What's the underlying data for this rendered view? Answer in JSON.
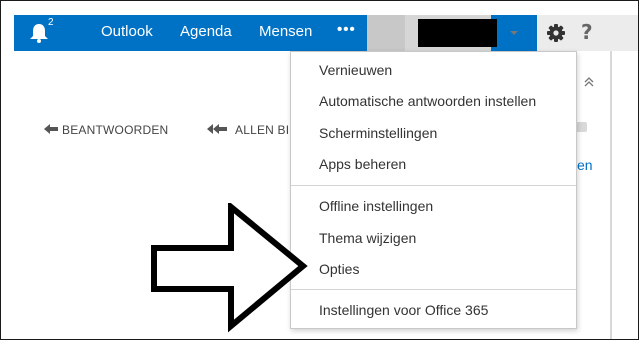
{
  "topbar": {
    "notification_count": "2",
    "links": [
      "Outlook",
      "Agenda",
      "Mensen"
    ],
    "more_label": "•••",
    "help_label": "?",
    "icons": [
      "bell-icon",
      "chevron-down-icon",
      "gear-icon",
      "help-icon"
    ],
    "colors": {
      "bar": "#0072c6",
      "text": "#ffffff"
    }
  },
  "mail_toolbar": {
    "reply_label": "BEANTWOORDEN",
    "reply_all_label": "ALLEN BI",
    "partial_link_text": "en"
  },
  "settings_menu": {
    "groups": [
      [
        "Vernieuwen",
        "Automatische antwoorden instellen",
        "Scherminstellingen",
        "Apps beheren"
      ],
      [
        "Offline instellingen",
        "Thema wijzigen",
        "Opties"
      ],
      [
        "Instellingen voor Office 365"
      ]
    ]
  }
}
